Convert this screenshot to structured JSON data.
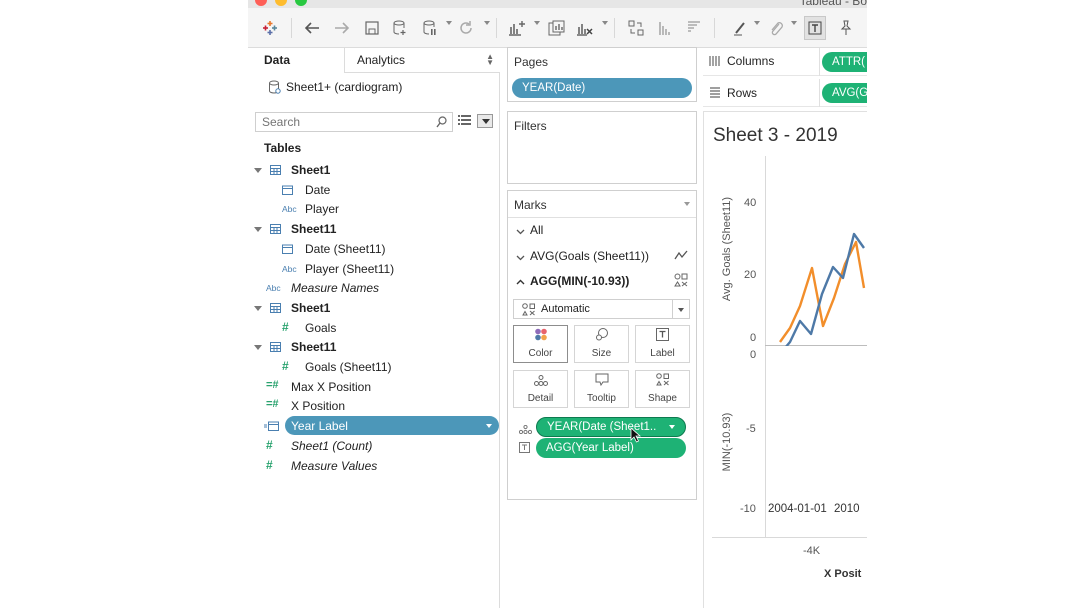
{
  "window": {
    "title": "Tableau - Bo"
  },
  "toolbar": {
    "icons": [
      "tableau-logo-icon",
      "back-icon",
      "forward-icon",
      "save-icon",
      "new-datasource-icon",
      "pause-updates-icon",
      "refresh-icon",
      "new-worksheet-icon",
      "duplicate-icon",
      "clear-sheet-icon",
      "swap-icon",
      "sort-asc-icon",
      "sort-desc-icon",
      "highlight-icon",
      "annotate-icon",
      "show-mark-labels-icon",
      "pin-icon"
    ]
  },
  "data_pane": {
    "tab_data": "Data",
    "tab_analytics": "Analytics",
    "datasource": "Sheet1+ (cardiogram)",
    "search_placeholder": "Search",
    "tables_heading": "Tables",
    "tree": [
      {
        "label": "Sheet1",
        "kind": "table",
        "bold": true
      },
      {
        "label": "Date",
        "kind": "date",
        "indent": 1
      },
      {
        "label": "Player",
        "kind": "abc",
        "indent": 1
      },
      {
        "label": "Sheet11",
        "kind": "table",
        "bold": true
      },
      {
        "label": "Date (Sheet11)",
        "kind": "date",
        "indent": 1
      },
      {
        "label": "Player (Sheet11)",
        "kind": "abc",
        "indent": 1
      },
      {
        "label": "Measure Names",
        "kind": "abc",
        "italic": true
      },
      {
        "label": "Sheet1",
        "kind": "table",
        "bold": true
      },
      {
        "label": "Goals",
        "kind": "num",
        "indent": 1
      },
      {
        "label": "Sheet11",
        "kind": "table",
        "bold": true
      },
      {
        "label": "Goals (Sheet11)",
        "kind": "num",
        "indent": 1
      },
      {
        "label": "Max X Position",
        "kind": "calc"
      },
      {
        "label": "X Position",
        "kind": "calc"
      },
      {
        "label": "Year Label",
        "kind": "calcdate",
        "selected": true
      },
      {
        "label": "Sheet1 (Count)",
        "kind": "num",
        "italic": true
      },
      {
        "label": "Measure Values",
        "kind": "num",
        "italic": true
      }
    ]
  },
  "pages": {
    "title": "Pages",
    "pill": "YEAR(Date)"
  },
  "filters": {
    "title": "Filters"
  },
  "marks": {
    "title": "Marks",
    "all": "All",
    "card1": "AVG(Goals (Sheet11))",
    "card2": "AGG(MIN(-10.93))",
    "mark_type": "Automatic",
    "buttons": [
      "Color",
      "Size",
      "Label",
      "Detail",
      "Tooltip",
      "Shape"
    ],
    "pill_detail": "YEAR(Date (Sheet1..",
    "pill_label": "AGG(Year Label)"
  },
  "viz": {
    "columns_label": "Columns",
    "columns_pill": "ATTR(",
    "rows_label": "Rows",
    "rows_pill": "AVG(G",
    "sheet_title": "Sheet 3 - 2019",
    "upper_axis_title": "Avg. Goals (Sheet11)",
    "upper_ticks": [
      "40",
      "20",
      "0"
    ],
    "lower_axis_title": "MIN(-10.93)",
    "lower_ticks": [
      "0",
      "-5",
      "-10"
    ],
    "date_labels": [
      "2004-01-01",
      "2010"
    ],
    "x_tick": "-4K",
    "x_title": "X Posit",
    "colors": {
      "blue_series": "#4e79a7",
      "orange_series": "#f28e2b"
    }
  }
}
